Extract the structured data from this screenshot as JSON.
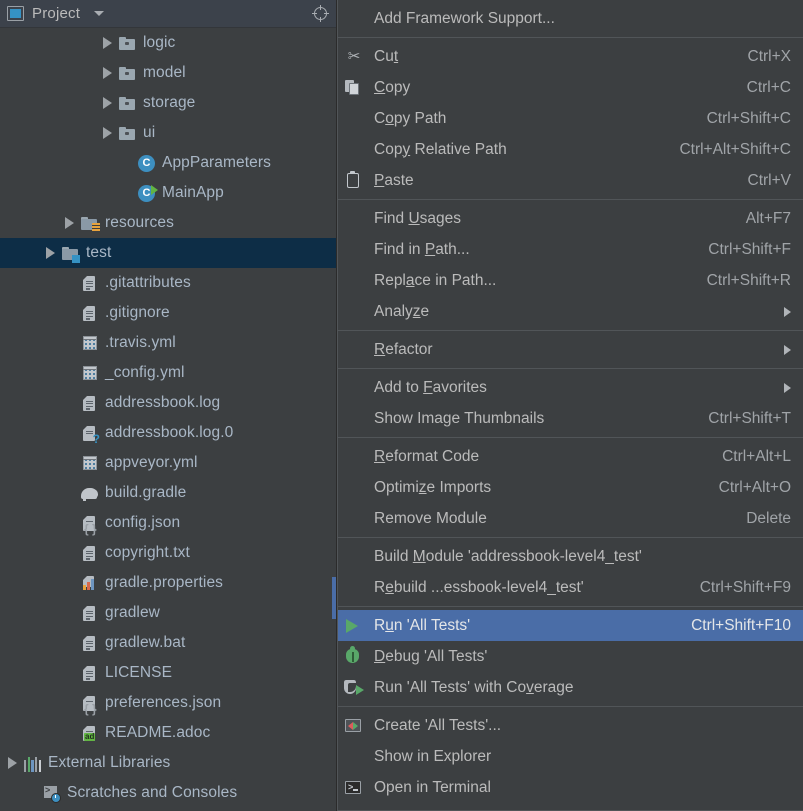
{
  "panel": {
    "title": "Project",
    "icon": "project-window-icon",
    "dropdown_icon": "chevron-down-icon",
    "locate_icon": "locate-target-icon"
  },
  "tree": {
    "items": [
      {
        "label": "logic",
        "icon": "folder-icon",
        "indent": 5,
        "arrow": "collapsed",
        "selected": false
      },
      {
        "label": "model",
        "icon": "folder-icon",
        "indent": 5,
        "arrow": "collapsed",
        "selected": false
      },
      {
        "label": "storage",
        "icon": "folder-icon",
        "indent": 5,
        "arrow": "collapsed",
        "selected": false
      },
      {
        "label": "ui",
        "icon": "folder-icon",
        "indent": 5,
        "arrow": "collapsed",
        "selected": false
      },
      {
        "label": "AppParameters",
        "icon": "java-class-icon",
        "indent": 6,
        "arrow": "none",
        "selected": false
      },
      {
        "label": "MainApp",
        "icon": "java-runnable-class-icon",
        "indent": 6,
        "arrow": "none",
        "selected": false
      },
      {
        "label": "resources",
        "icon": "resources-folder-icon",
        "indent": 3,
        "arrow": "collapsed",
        "selected": false
      },
      {
        "label": "test",
        "icon": "test-folder-icon",
        "indent": 2,
        "arrow": "collapsed",
        "selected": true
      },
      {
        "label": ".gitattributes",
        "icon": "text-file-icon",
        "indent": 3,
        "arrow": "none",
        "selected": false
      },
      {
        "label": ".gitignore",
        "icon": "text-file-icon",
        "indent": 3,
        "arrow": "none",
        "selected": false
      },
      {
        "label": ".travis.yml",
        "icon": "yaml-file-icon",
        "indent": 3,
        "arrow": "none",
        "selected": false
      },
      {
        "label": "_config.yml",
        "icon": "yaml-file-icon",
        "indent": 3,
        "arrow": "none",
        "selected": false
      },
      {
        "label": "addressbook.log",
        "icon": "text-file-icon",
        "indent": 3,
        "arrow": "none",
        "selected": false
      },
      {
        "label": "addressbook.log.0",
        "icon": "unknown-file-icon",
        "indent": 3,
        "arrow": "none",
        "selected": false
      },
      {
        "label": "appveyor.yml",
        "icon": "yaml-file-icon",
        "indent": 3,
        "arrow": "none",
        "selected": false
      },
      {
        "label": "build.gradle",
        "icon": "gradle-file-icon",
        "indent": 3,
        "arrow": "none",
        "selected": false
      },
      {
        "label": "config.json",
        "icon": "json-file-icon",
        "indent": 3,
        "arrow": "none",
        "selected": false
      },
      {
        "label": "copyright.txt",
        "icon": "text-file-icon",
        "indent": 3,
        "arrow": "none",
        "selected": false
      },
      {
        "label": "gradle.properties",
        "icon": "properties-file-icon",
        "indent": 3,
        "arrow": "none",
        "selected": false
      },
      {
        "label": "gradlew",
        "icon": "text-file-icon",
        "indent": 3,
        "arrow": "none",
        "selected": false
      },
      {
        "label": "gradlew.bat",
        "icon": "text-file-icon",
        "indent": 3,
        "arrow": "none",
        "selected": false
      },
      {
        "label": "LICENSE",
        "icon": "text-file-icon",
        "indent": 3,
        "arrow": "none",
        "selected": false
      },
      {
        "label": "preferences.json",
        "icon": "json-file-icon",
        "indent": 3,
        "arrow": "none",
        "selected": false
      },
      {
        "label": "README.adoc",
        "icon": "asciidoc-file-icon",
        "indent": 3,
        "arrow": "none",
        "selected": false
      },
      {
        "label": "External Libraries",
        "icon": "external-libraries-icon",
        "indent": 0,
        "arrow": "collapsed",
        "selected": false
      },
      {
        "label": "Scratches and Consoles",
        "icon": "scratches-icon",
        "indent": 1,
        "arrow": "none",
        "selected": false
      }
    ]
  },
  "context_menu": {
    "groups": [
      {
        "items": [
          {
            "label": "Add Framework Support...",
            "shortcut": "",
            "icon": "",
            "mnemonic": "",
            "submenu": false,
            "highlight": false
          }
        ]
      },
      {
        "items": [
          {
            "label": "Cut",
            "shortcut": "Ctrl+X",
            "icon": "scissors-icon",
            "mnemonic": "t",
            "submenu": false,
            "highlight": false
          },
          {
            "label": "Copy",
            "shortcut": "Ctrl+C",
            "icon": "copy-icon",
            "mnemonic": "C",
            "submenu": false,
            "highlight": false
          },
          {
            "label": "Copy Path",
            "shortcut": "Ctrl+Shift+C",
            "icon": "",
            "mnemonic": "o",
            "submenu": false,
            "highlight": false
          },
          {
            "label": "Copy Relative Path",
            "shortcut": "Ctrl+Alt+Shift+C",
            "icon": "",
            "mnemonic": "y",
            "submenu": false,
            "highlight": false
          },
          {
            "label": "Paste",
            "shortcut": "Ctrl+V",
            "icon": "paste-icon",
            "mnemonic": "P",
            "submenu": false,
            "highlight": false
          }
        ]
      },
      {
        "items": [
          {
            "label": "Find Usages",
            "shortcut": "Alt+F7",
            "icon": "",
            "mnemonic": "U",
            "submenu": false,
            "highlight": false
          },
          {
            "label": "Find in Path...",
            "shortcut": "Ctrl+Shift+F",
            "icon": "",
            "mnemonic": "P",
            "submenu": false,
            "highlight": false
          },
          {
            "label": "Replace in Path...",
            "shortcut": "Ctrl+Shift+R",
            "icon": "",
            "mnemonic": "a",
            "submenu": false,
            "highlight": false
          },
          {
            "label": "Analyze",
            "shortcut": "",
            "icon": "",
            "mnemonic": "z",
            "submenu": true,
            "highlight": false
          }
        ]
      },
      {
        "items": [
          {
            "label": "Refactor",
            "shortcut": "",
            "icon": "",
            "mnemonic": "R",
            "submenu": true,
            "highlight": false
          }
        ]
      },
      {
        "items": [
          {
            "label": "Add to Favorites",
            "shortcut": "",
            "icon": "",
            "mnemonic": "F",
            "submenu": true,
            "highlight": false
          },
          {
            "label": "Show Image Thumbnails",
            "shortcut": "Ctrl+Shift+T",
            "icon": "",
            "mnemonic": "",
            "submenu": false,
            "highlight": false
          }
        ]
      },
      {
        "items": [
          {
            "label": "Reformat Code",
            "shortcut": "Ctrl+Alt+L",
            "icon": "",
            "mnemonic": "R",
            "submenu": false,
            "highlight": false
          },
          {
            "label": "Optimize Imports",
            "shortcut": "Ctrl+Alt+O",
            "icon": "",
            "mnemonic": "z",
            "submenu": false,
            "highlight": false
          },
          {
            "label": "Remove Module",
            "shortcut": "Delete",
            "icon": "",
            "mnemonic": "",
            "submenu": false,
            "highlight": false
          }
        ]
      },
      {
        "items": [
          {
            "label": "Build Module 'addressbook-level4_test'",
            "shortcut": "",
            "icon": "",
            "mnemonic": "M",
            "submenu": false,
            "highlight": false
          },
          {
            "label": "Rebuild ...essbook-level4_test'",
            "shortcut": "Ctrl+Shift+F9",
            "icon": "",
            "mnemonic": "e",
            "submenu": false,
            "highlight": false
          }
        ]
      },
      {
        "items": [
          {
            "label": "Run 'All Tests'",
            "shortcut": "Ctrl+Shift+F10",
            "icon": "run-icon",
            "mnemonic": "u",
            "submenu": false,
            "highlight": true
          },
          {
            "label": "Debug 'All Tests'",
            "shortcut": "",
            "icon": "debug-icon",
            "mnemonic": "D",
            "submenu": false,
            "highlight": false
          },
          {
            "label": "Run 'All Tests' with Coverage",
            "shortcut": "",
            "icon": "coverage-icon",
            "mnemonic": "v",
            "submenu": false,
            "highlight": false
          }
        ]
      },
      {
        "items": [
          {
            "label": "Create 'All Tests'...",
            "shortcut": "",
            "icon": "run-config-icon",
            "mnemonic": "",
            "submenu": false,
            "highlight": false
          },
          {
            "label": "Show in Explorer",
            "shortcut": "",
            "icon": "",
            "mnemonic": "",
            "submenu": false,
            "highlight": false
          },
          {
            "label": "Open in Terminal",
            "shortcut": "",
            "icon": "terminal-icon",
            "mnemonic": "",
            "submenu": false,
            "highlight": false
          }
        ]
      }
    ]
  },
  "colors": {
    "background": "#3c3f41",
    "header_background": "#3c424b",
    "menu_highlight": "#4a6da7",
    "tree_selection": "#0d2d46",
    "text": "#bbbbbb",
    "tree_text": "#a9b7c6",
    "accent_blue": "#3592c4",
    "accent_green": "#59a869",
    "separator": "#515558"
  }
}
